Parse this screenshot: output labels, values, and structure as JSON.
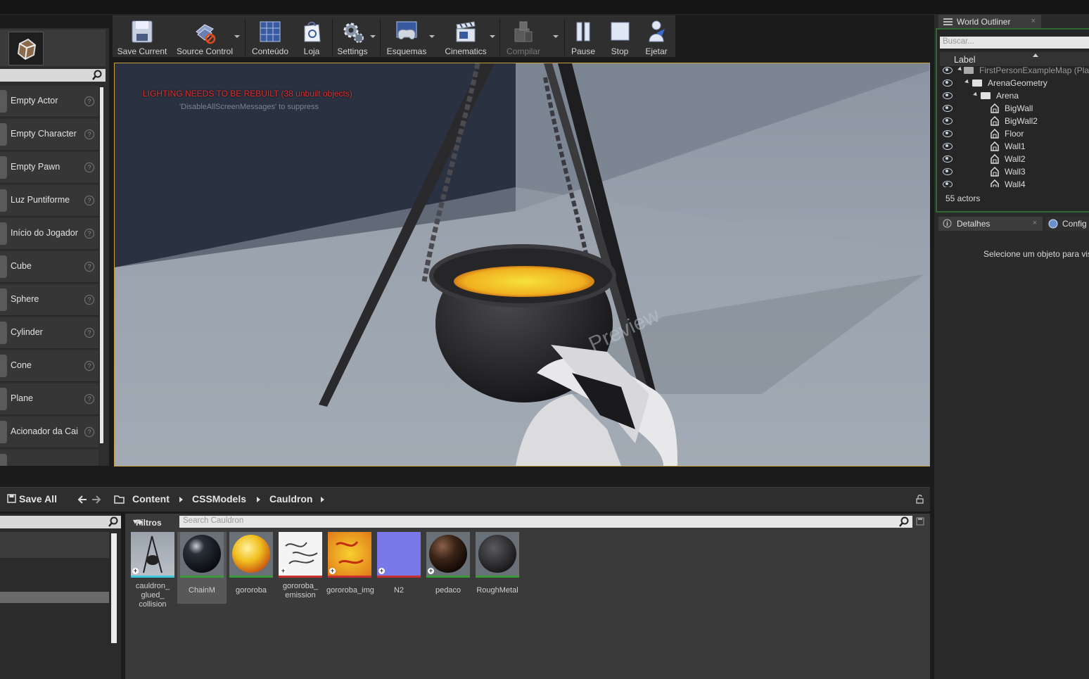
{
  "toolbar": {
    "save_current": "Save Current",
    "source_control": "Source Control",
    "conteudo": "Conteúdo",
    "loja": "Loja",
    "settings": "Settings",
    "esquemas": "Esquemas",
    "cinematics": "Cinematics",
    "compilar": "Compilar",
    "pause": "Pause",
    "stop": "Stop",
    "ejetar": "Ejetar"
  },
  "place_items": [
    "Empty Actor",
    "Empty Character",
    "Empty Pawn",
    "Luz Puntiforme",
    "Início do Jogador",
    "Cube",
    "Sphere",
    "Cylinder",
    "Cone",
    "Plane",
    "Acionador da Cai"
  ],
  "viewport": {
    "warning": "LIGHTING NEEDS TO BE REBUILT (38 unbuilt objects)",
    "warning_sub": "'DisableAllScreenMessages' to suppress"
  },
  "outliner": {
    "tab": "World Outliner",
    "search_placeholder": "Buscar...",
    "column_label": "Label",
    "rows": [
      "FirstPersonExampleMap (Pla",
      "ArenaGeometry",
      "Arena",
      "BigWall",
      "BigWall2",
      "Floor",
      "Wall1",
      "Wall2",
      "Wall3",
      "Wall4"
    ],
    "count": "55 actors"
  },
  "details": {
    "tab": "Detalhes",
    "tab2": "Config",
    "empty": "Selecione um objeto para vis"
  },
  "content_browser": {
    "save_all": "Save All",
    "path": [
      "Content",
      "CSSModels",
      "Cauldron"
    ],
    "filters": "Filtros",
    "search_placeholder": "Search Cauldron",
    "assets": [
      {
        "name": "cauldron_\nglued_\ncollision",
        "color": "#3cc8d8"
      },
      {
        "name": "ChainM",
        "color": "#3a9a3a"
      },
      {
        "name": "gororoba",
        "color": "#3a9a3a"
      },
      {
        "name": "gororoba_\nemission",
        "color": "#c83030"
      },
      {
        "name": "gororoba_img",
        "color": "#c83030"
      },
      {
        "name": "N2",
        "color": "#c83030"
      },
      {
        "name": "pedaco",
        "color": "#3a9a3a"
      },
      {
        "name": "RoughMetal",
        "color": "#3a9a3a"
      }
    ]
  }
}
